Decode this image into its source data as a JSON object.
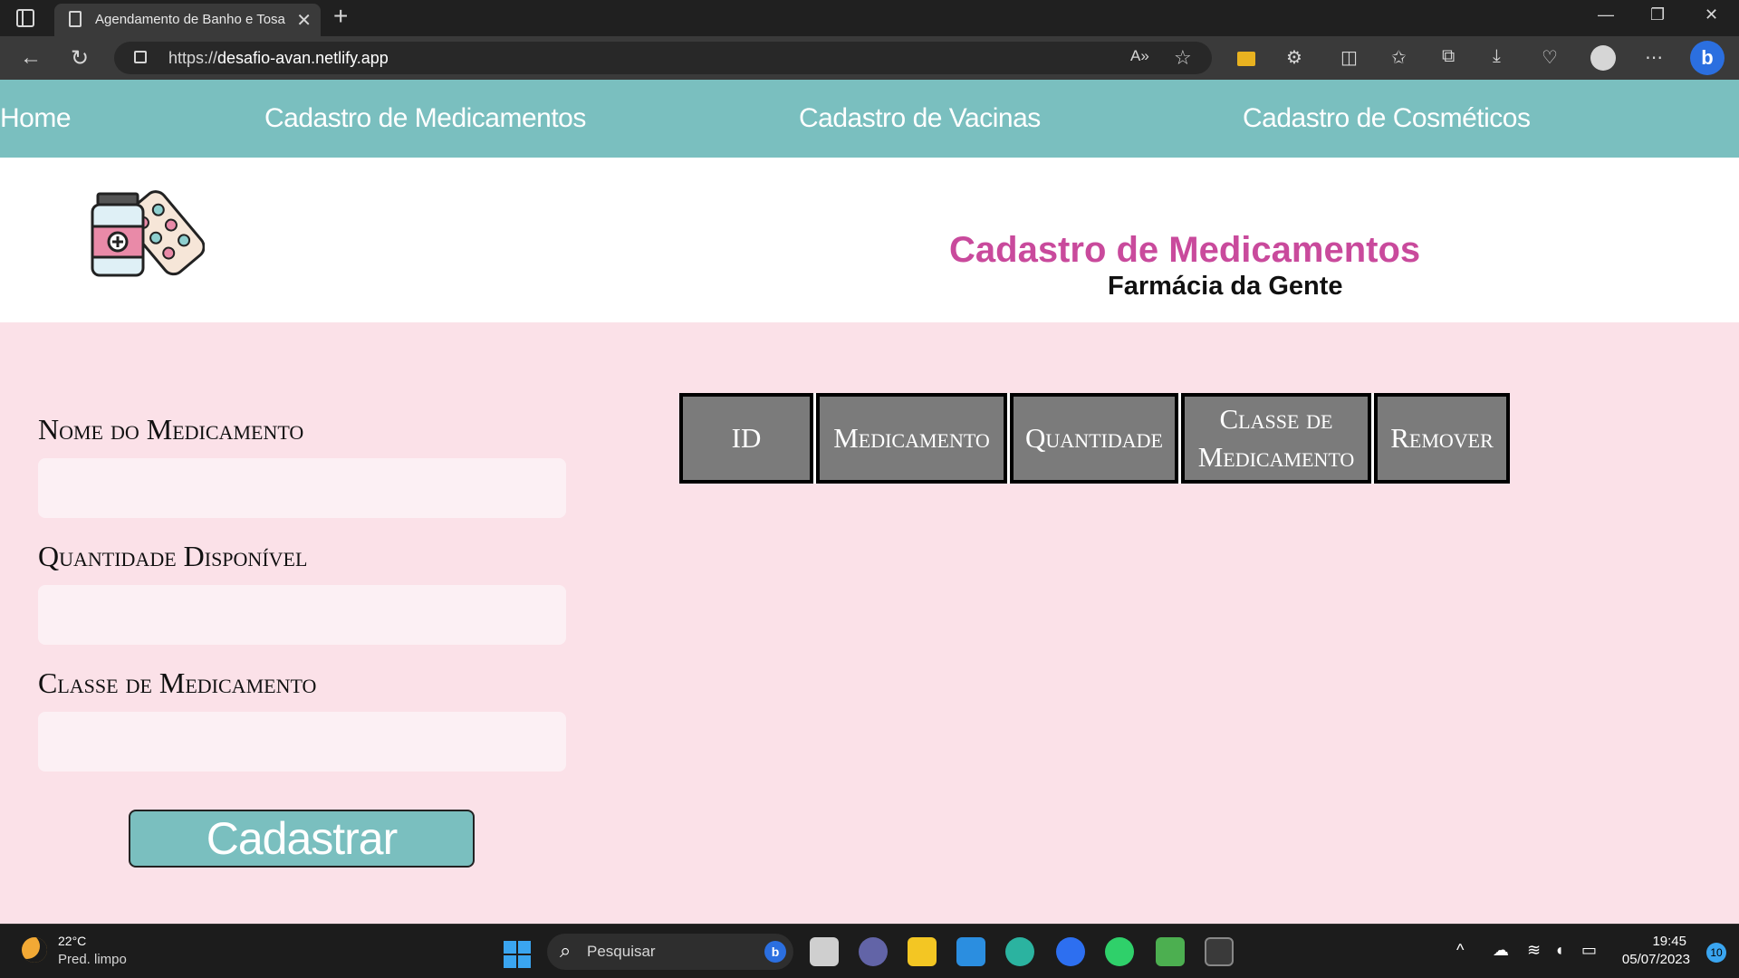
{
  "browser": {
    "tab_title": "Agendamento de Banho e Tosa",
    "tab_close": "✕",
    "new_tab": "+",
    "url_scheme": "https://",
    "url_host": "desafio-avan.netlify.app",
    "window_controls": {
      "minimize": "—",
      "restore": "❐",
      "close": "✕"
    },
    "icons": [
      "back-icon",
      "refresh-icon",
      "lock-icon",
      "read-aloud-icon",
      "favorite-star-icon",
      "extension-icon",
      "split-screen-icon",
      "favorites-icon",
      "collections-icon",
      "download-icon",
      "health-icon",
      "profile-icon",
      "more-icon",
      "bing-icon"
    ]
  },
  "nav": {
    "items": [
      {
        "label": "Home"
      },
      {
        "label": "Cadastro de Medicamentos"
      },
      {
        "label": "Cadastro de Vacinas"
      },
      {
        "label": "Cadastro de Cosméticos"
      }
    ]
  },
  "header": {
    "title": "Cadastro de Medicamentos",
    "subtitle": "Farmácia da Gente",
    "logo_icon": "medicine-bottle-pills-icon"
  },
  "form": {
    "fields": [
      {
        "label": "Nome do Medicamento",
        "value": ""
      },
      {
        "label": "Quantidade Disponível",
        "value": ""
      },
      {
        "label": "Classe de Medicamento",
        "value": ""
      }
    ],
    "submit_label": "Cadastrar"
  },
  "table": {
    "columns": [
      "ID",
      "Medicamento",
      "Quantidade",
      "Classe de Medicamento",
      "Remover"
    ],
    "rows": []
  },
  "taskbar": {
    "weather_temp": "22°C",
    "weather_desc": "Pred. limpo",
    "search_placeholder": "Pesquisar",
    "time": "19:45",
    "date": "05/07/2023",
    "notification_count": "10"
  },
  "colors": {
    "nav_bg": "#7abfbf",
    "page_bg": "#fbe1e8",
    "title_color": "#c94a9c",
    "table_header_bg": "#7b7b7b"
  }
}
